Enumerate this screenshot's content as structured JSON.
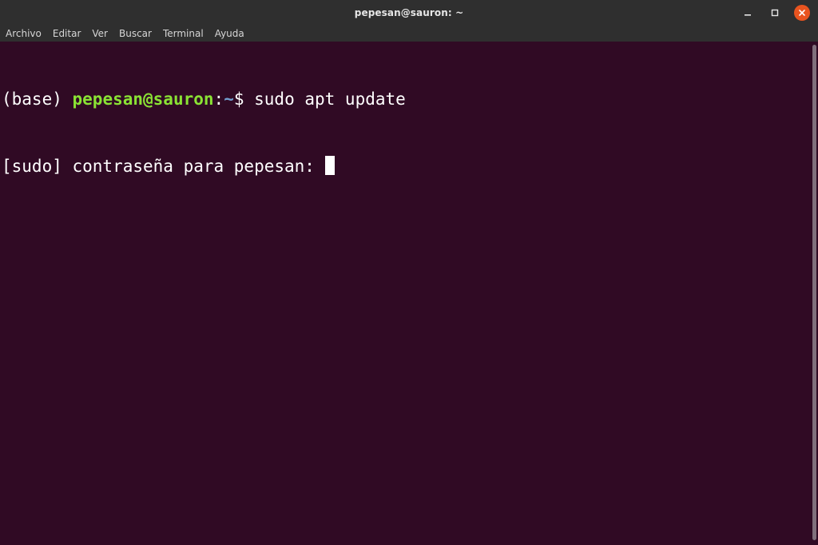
{
  "window": {
    "title": "pepesan@sauron: ~"
  },
  "menu": {
    "items": [
      "Archivo",
      "Editar",
      "Ver",
      "Buscar",
      "Terminal",
      "Ayuda"
    ]
  },
  "terminal": {
    "line1": {
      "env": "(base) ",
      "user_host": "pepesan@sauron",
      "sep": ":",
      "path": "~",
      "prompt": "$ ",
      "command": "sudo apt update"
    },
    "line2": {
      "text": "[sudo] contraseña para pepesan: "
    }
  },
  "colors": {
    "terminal_bg": "#300a24",
    "user_host": "#8ae234",
    "path": "#729fcf",
    "close_button": "#e9541f"
  }
}
